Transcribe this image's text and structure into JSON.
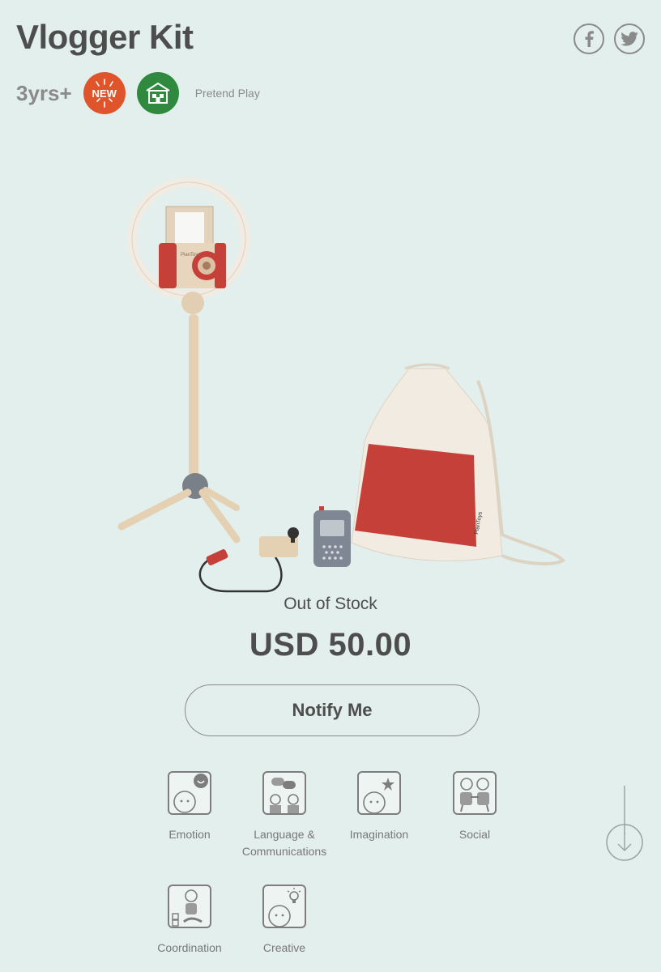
{
  "product": {
    "title": "Vlogger Kit",
    "age": "3yrs+",
    "new_badge": "NEW",
    "category": "Pretend Play",
    "stock_status": "Out of Stock",
    "price": "USD 50.00",
    "notify_label": "Notify Me",
    "brand_on_bag": "PlanToys"
  },
  "share": {
    "icons": [
      "facebook-icon",
      "twitter-icon"
    ]
  },
  "skills": [
    {
      "label": "Emotion",
      "icon": "emotion-icon"
    },
    {
      "label": "Language &\nCommunications",
      "icon": "language-icon"
    },
    {
      "label": "Imagination",
      "icon": "imagination-icon"
    },
    {
      "label": "Social",
      "icon": "social-icon"
    },
    {
      "label": "Coordination",
      "icon": "coordination-icon"
    },
    {
      "label": "Creative",
      "icon": "creative-icon"
    }
  ],
  "colors": {
    "background": "#e3efec",
    "new_badge": "#e0542b",
    "play_badge": "#2f8a3f",
    "text": "#4d4d4d"
  }
}
